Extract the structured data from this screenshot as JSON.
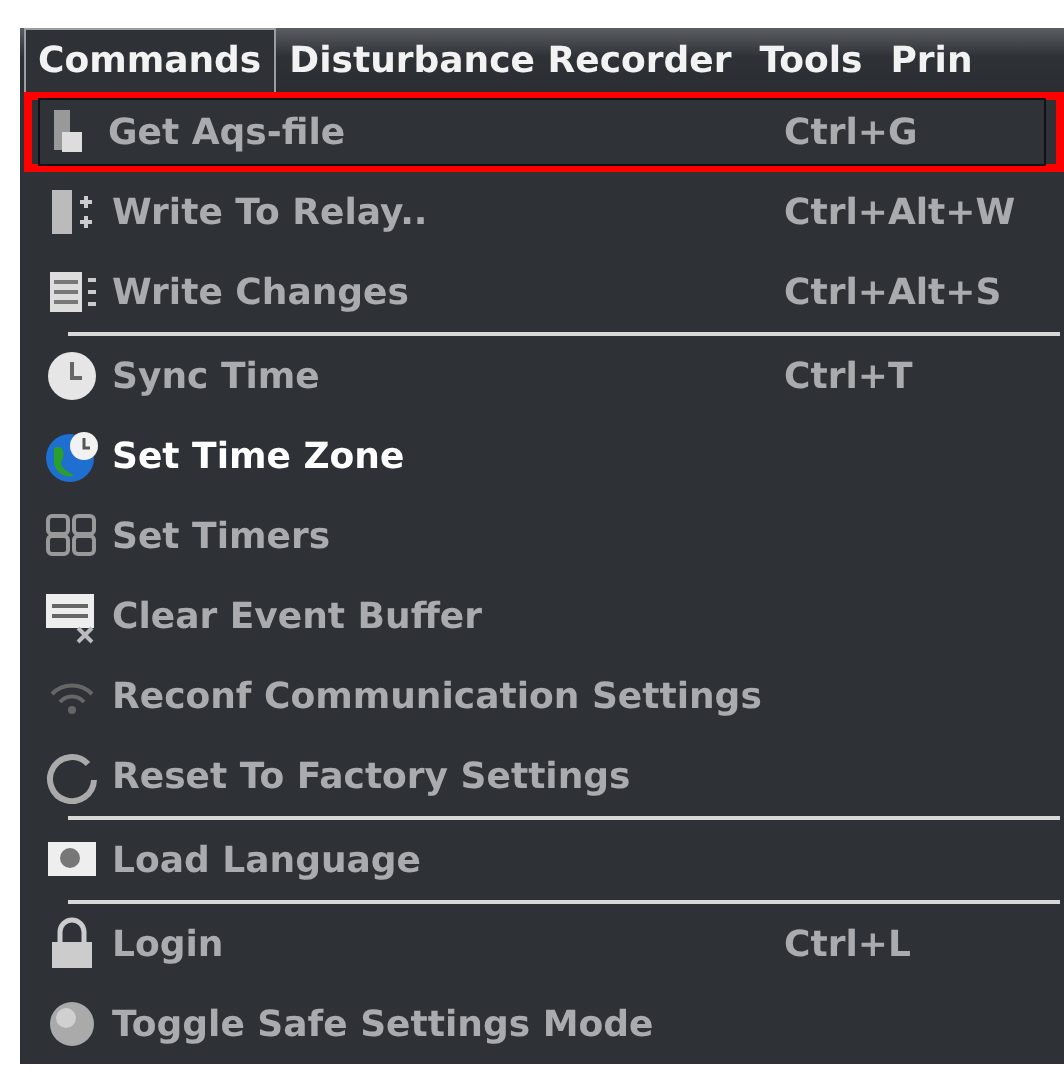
{
  "menu_bar": [
    {
      "label": "Commands",
      "selected": true
    },
    {
      "label": "Disturbance Recorder",
      "selected": false
    },
    {
      "label": "Tools",
      "selected": false
    },
    {
      "label": "Prin",
      "selected": false
    }
  ],
  "menu_items": [
    {
      "kind": "item",
      "label": "Get Aqs-file",
      "shortcut": "Ctrl+G",
      "disabled": true,
      "selected": true
    },
    {
      "kind": "item",
      "label": "Write To Relay..",
      "shortcut": "Ctrl+Alt+W",
      "disabled": true,
      "selected": false
    },
    {
      "kind": "item",
      "label": "Write Changes",
      "shortcut": "Ctrl+Alt+S",
      "disabled": true,
      "selected": false
    },
    {
      "kind": "separator"
    },
    {
      "kind": "item",
      "label": "Sync Time",
      "shortcut": "Ctrl+T",
      "disabled": true,
      "selected": false
    },
    {
      "kind": "item",
      "label": "Set Time Zone",
      "disabled": false,
      "selected": false
    },
    {
      "kind": "item",
      "label": "Set Timers",
      "disabled": true,
      "selected": false
    },
    {
      "kind": "item",
      "label": "Clear Event Buffer",
      "disabled": true,
      "selected": false
    },
    {
      "kind": "item",
      "label": "Reconf Communication Settings",
      "disabled": true,
      "selected": false
    },
    {
      "kind": "item",
      "label": "Reset To Factory Settings",
      "disabled": true,
      "selected": false
    },
    {
      "kind": "separator"
    },
    {
      "kind": "item",
      "label": "Load Language",
      "disabled": true,
      "selected": false
    },
    {
      "kind": "separator"
    },
    {
      "kind": "item",
      "label": "Login",
      "shortcut": "Ctrl+L",
      "disabled": true,
      "selected": false
    },
    {
      "kind": "item",
      "label": "Toggle Safe Settings Mode",
      "disabled": true,
      "selected": false
    }
  ]
}
